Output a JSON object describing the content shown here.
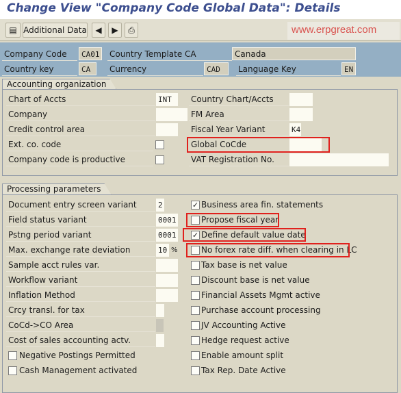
{
  "title": "Change View \"Company Code Global Data\": Details",
  "toolbar": {
    "additional_data": "Additional Data",
    "watermark": "www.erpgreat.com",
    "icons": [
      "detail-icon",
      "previous-icon",
      "next-icon",
      "print-icon"
    ]
  },
  "header": {
    "company_code_label": "Company Code",
    "company_code": "CA01",
    "country_template_label": "Country Template CA",
    "country_name": "Canada",
    "country_key_label": "Country key",
    "country_key": "CA",
    "currency_label": "Currency",
    "currency": "CAD",
    "language_key_label": "Language Key",
    "language_key": "EN"
  },
  "accounting": {
    "title": "Accounting organization",
    "left": [
      {
        "label": "Chart of Accts",
        "value": "INT"
      },
      {
        "label": "Company",
        "value": ""
      },
      {
        "label": "Credit control area",
        "value": ""
      },
      {
        "label": "Ext. co. code",
        "checked": false
      },
      {
        "label": "Company code is productive",
        "checked": false
      }
    ],
    "right": [
      {
        "label": "Country Chart/Accts",
        "value": ""
      },
      {
        "label": "FM Area",
        "value": ""
      },
      {
        "label": "Fiscal Year Variant",
        "value": "K4"
      },
      {
        "label": "Global CoCde",
        "value": ""
      },
      {
        "label": "VAT Registration No.",
        "value": ""
      }
    ]
  },
  "processing": {
    "title": "Processing parameters",
    "left": [
      {
        "label": "Document entry screen variant",
        "value": "2"
      },
      {
        "label": "Field status variant",
        "value": "0001"
      },
      {
        "label": "Pstng period variant",
        "value": "0001"
      },
      {
        "label": "Max. exchange rate deviation",
        "value": "10",
        "unit": "%"
      },
      {
        "label": "Sample acct rules var.",
        "value": ""
      },
      {
        "label": "Workflow variant",
        "value": ""
      },
      {
        "label": "Inflation Method",
        "value": ""
      },
      {
        "label": "Crcy transl. for tax",
        "value": ""
      },
      {
        "label": "CoCd->CO Area",
        "value": ""
      },
      {
        "label": "Cost of sales accounting actv.",
        "value": ""
      },
      {
        "label": "Negative Postings Permitted",
        "checked": false
      },
      {
        "label": "Cash Management activated",
        "checked": false
      }
    ],
    "right": [
      {
        "label": "Business area fin. statements",
        "checked": true
      },
      {
        "label": "Propose fiscal year",
        "checked": false
      },
      {
        "label": "Define default value date",
        "checked": true
      },
      {
        "label": "No forex rate diff. when clearing in LC",
        "checked": false
      },
      {
        "label": "Tax base is net value",
        "checked": false
      },
      {
        "label": "Discount base is net value",
        "checked": false
      },
      {
        "label": "Financial Assets Mgmt active",
        "checked": false
      },
      {
        "label": "Purchase account processing",
        "checked": false
      },
      {
        "label": "JV Accounting Active",
        "checked": false
      },
      {
        "label": "Hedge request active",
        "checked": false
      },
      {
        "label": "Enable amount split",
        "checked": false
      },
      {
        "label": "Tax Rep. Date Active",
        "checked": false
      }
    ]
  },
  "highlight_color": "#e0211d"
}
